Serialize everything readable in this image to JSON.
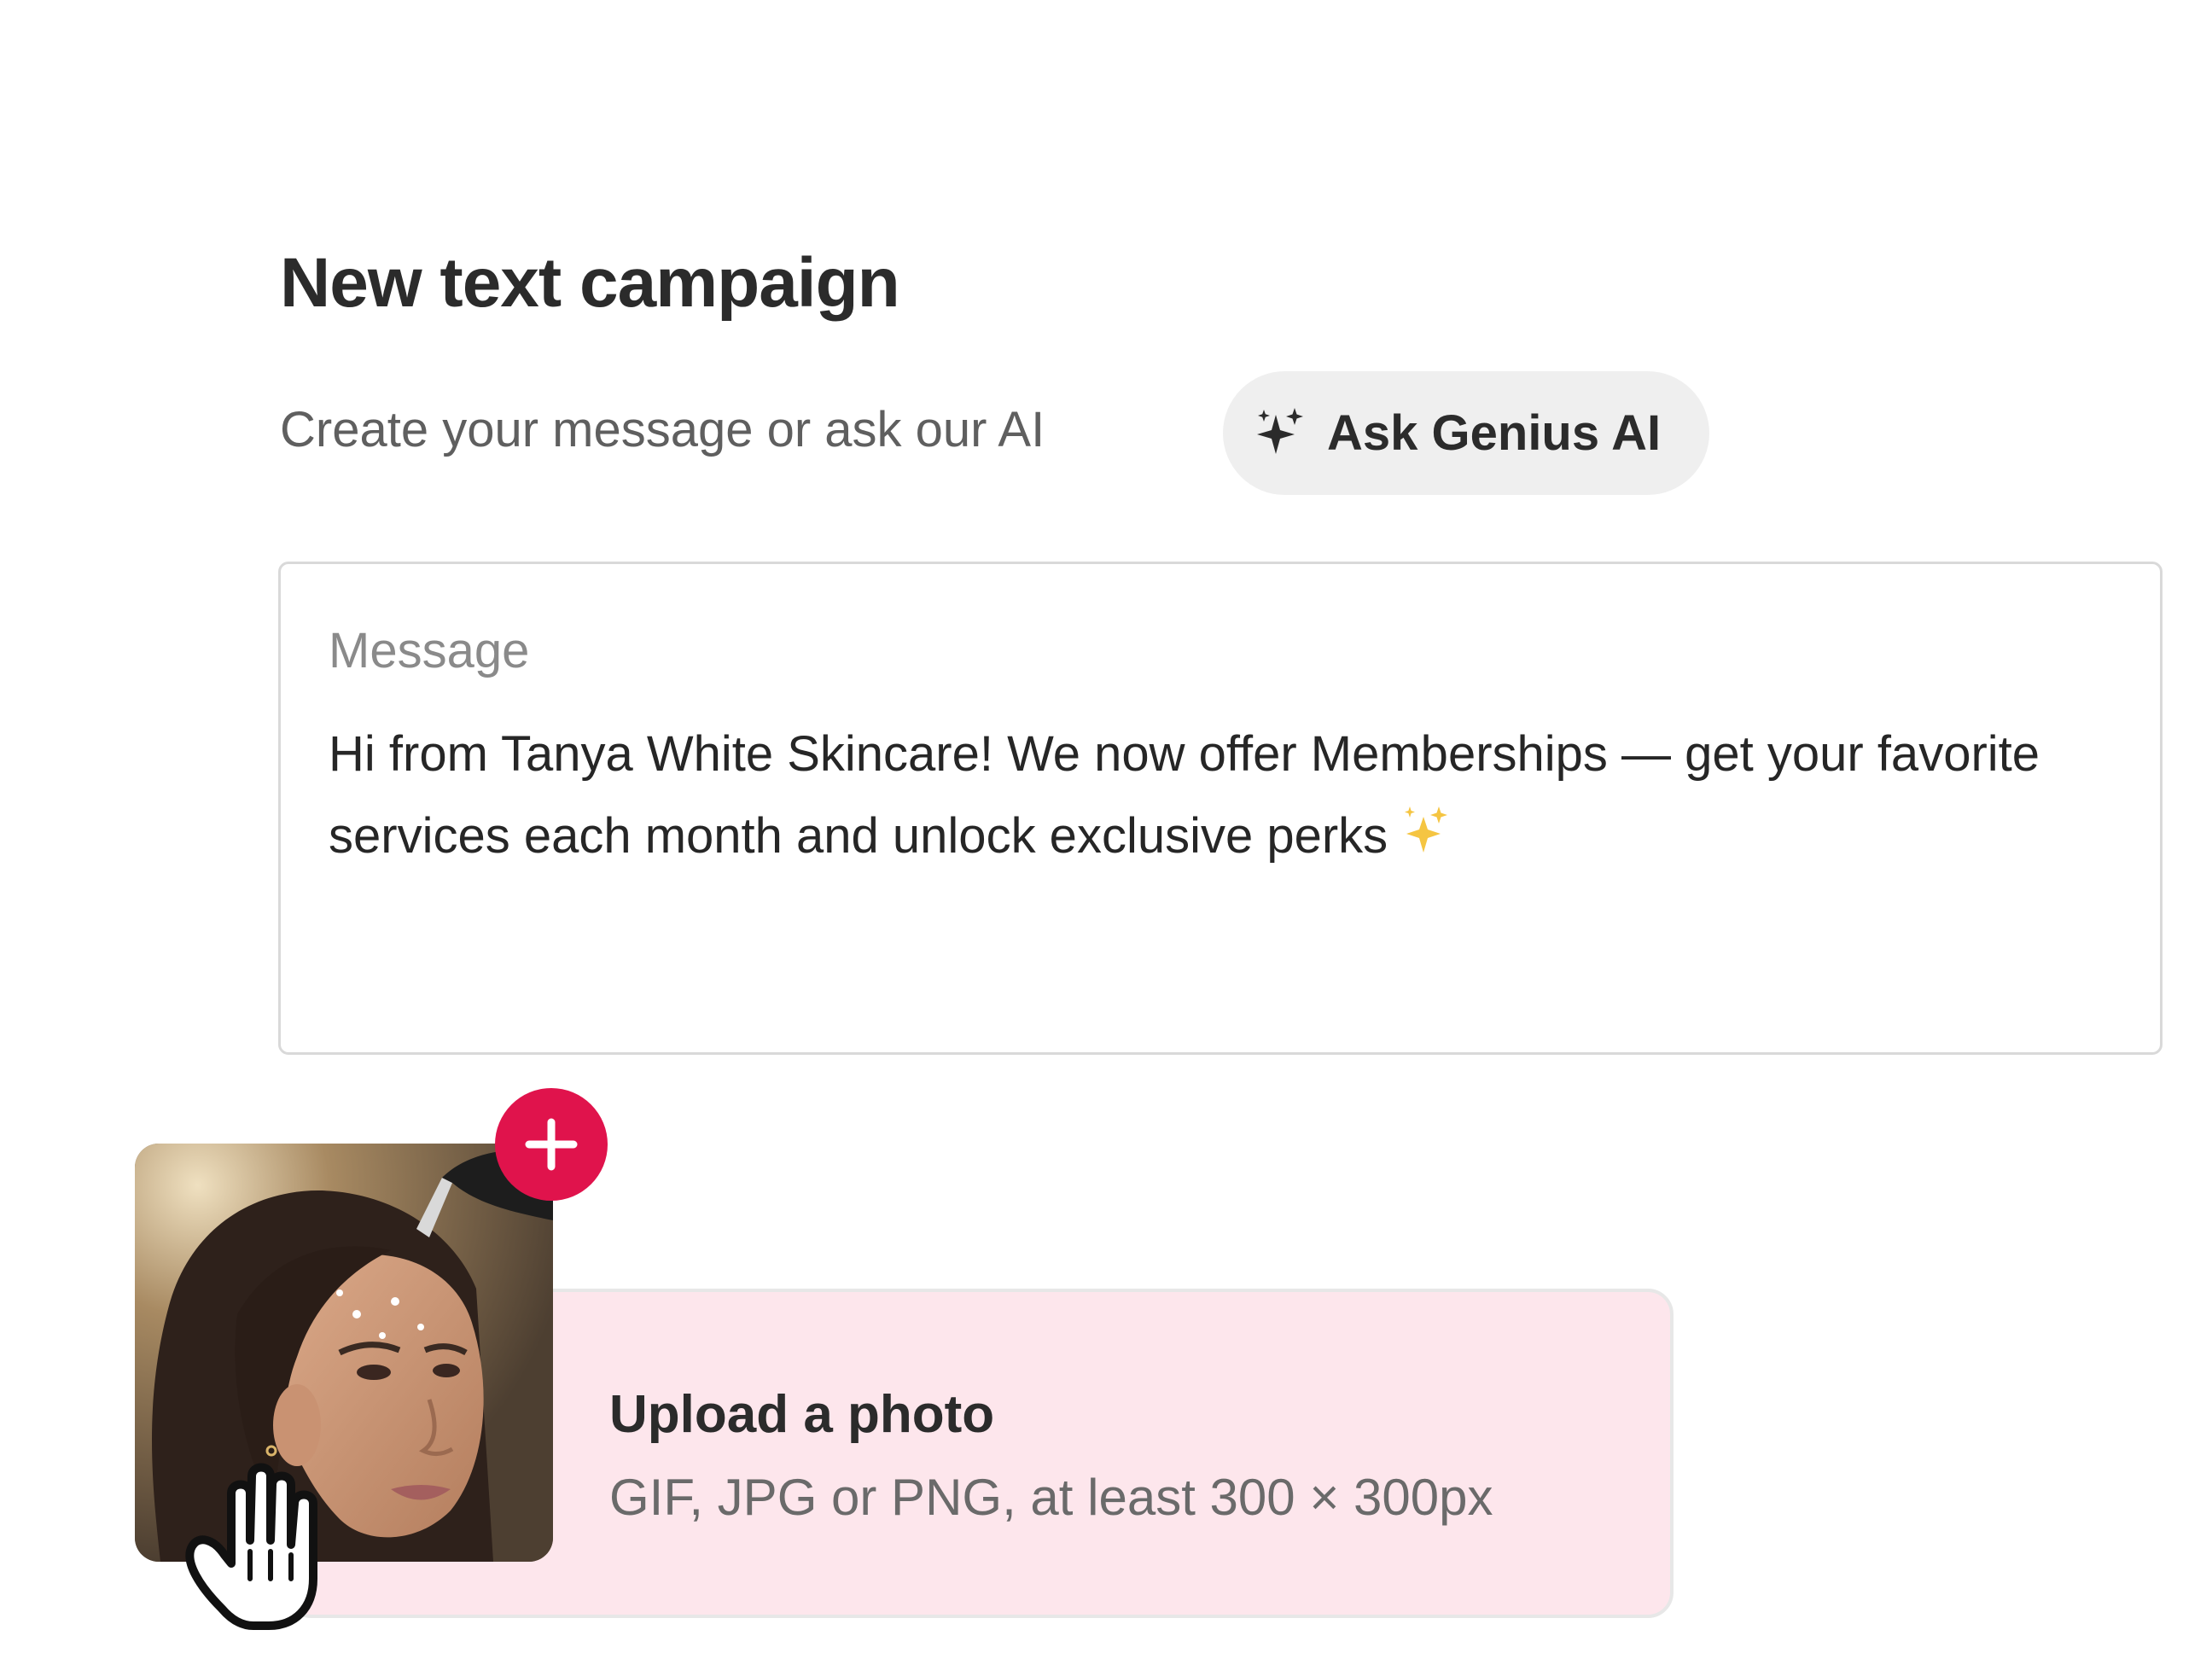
{
  "page": {
    "title": "New text campaign",
    "subtitle": "Create your message or ask our AI"
  },
  "ai_button": {
    "label": "Ask Genius AI",
    "icon": "sparkle-icon"
  },
  "message_field": {
    "label": "Message",
    "value": "Hi from Tanya White Skincare! We now offer Memberships — get your favorite services each month and unlock exclusive perks",
    "trailing_emoji": "sparkles"
  },
  "upload": {
    "title": "Upload a photo",
    "hint": "GIF, JPG or PNG, at least 300 × 300px",
    "add_icon": "plus-icon",
    "cursor_icon": "hand-cursor-icon"
  },
  "colors": {
    "accent": "#e0134c",
    "upload_bg": "#fde6ec",
    "ai_button_bg": "#efefef",
    "border": "#d9d9d9"
  }
}
